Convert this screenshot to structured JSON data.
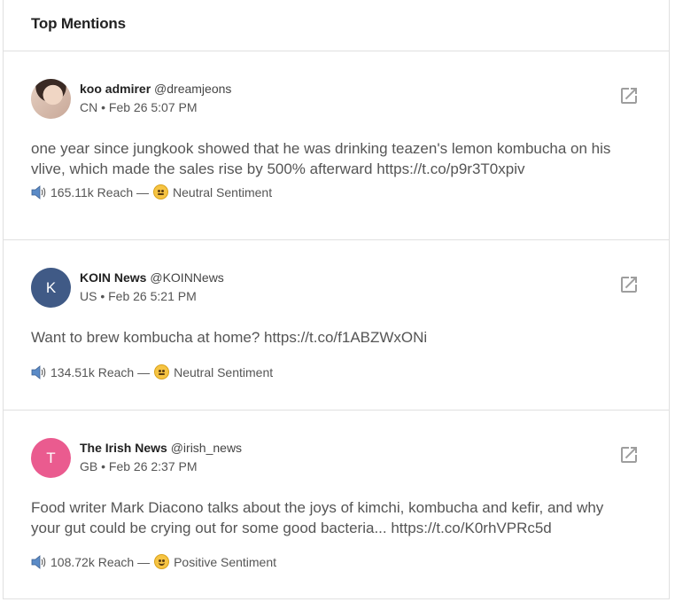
{
  "panel": {
    "title": "Top Mentions"
  },
  "mentions": [
    {
      "name": "koo admirer",
      "handle": "@dreamjeons",
      "meta": "CN • Feb 26 5:07 PM",
      "avatar_letter": "",
      "avatar_icon": "profile-photo",
      "text": "one year since jungkook showed that he was drinking teazen's lemon kombucha on his vlive, which made the sales rise by 500% afterward https://t.co/p9r3T0xpiv",
      "reach": "165.11k Reach",
      "separator": "—",
      "sentiment": "Neutral Sentiment",
      "sentiment_icon": "neutral-face-icon"
    },
    {
      "name": "KOIN News",
      "handle": "@KOINNews",
      "meta": "US • Feb 26 5:21 PM",
      "avatar_letter": "K",
      "avatar_color": "#405a86",
      "text": "Want to brew kombucha at home? https://t.co/f1ABZWxONi",
      "reach": "134.51k Reach",
      "separator": "—",
      "sentiment": "Neutral Sentiment",
      "sentiment_icon": "neutral-face-icon"
    },
    {
      "name": "The Irish News",
      "handle": "@irish_news",
      "meta": "GB • Feb 26 2:37 PM",
      "avatar_letter": "T",
      "avatar_color": "#ea5b8f",
      "text": "Food writer Mark Diacono talks about the joys of kimchi, kombucha and kefir, and why your gut could be crying out for some good bacteria... https://t.co/K0rhVPRc5d",
      "reach": "108.72k Reach",
      "separator": "—",
      "sentiment": "Positive Sentiment",
      "sentiment_icon": "smiling-face-icon"
    }
  ],
  "icons": {
    "external_link": "open-in-new-icon",
    "reach": "speaker-icon"
  }
}
